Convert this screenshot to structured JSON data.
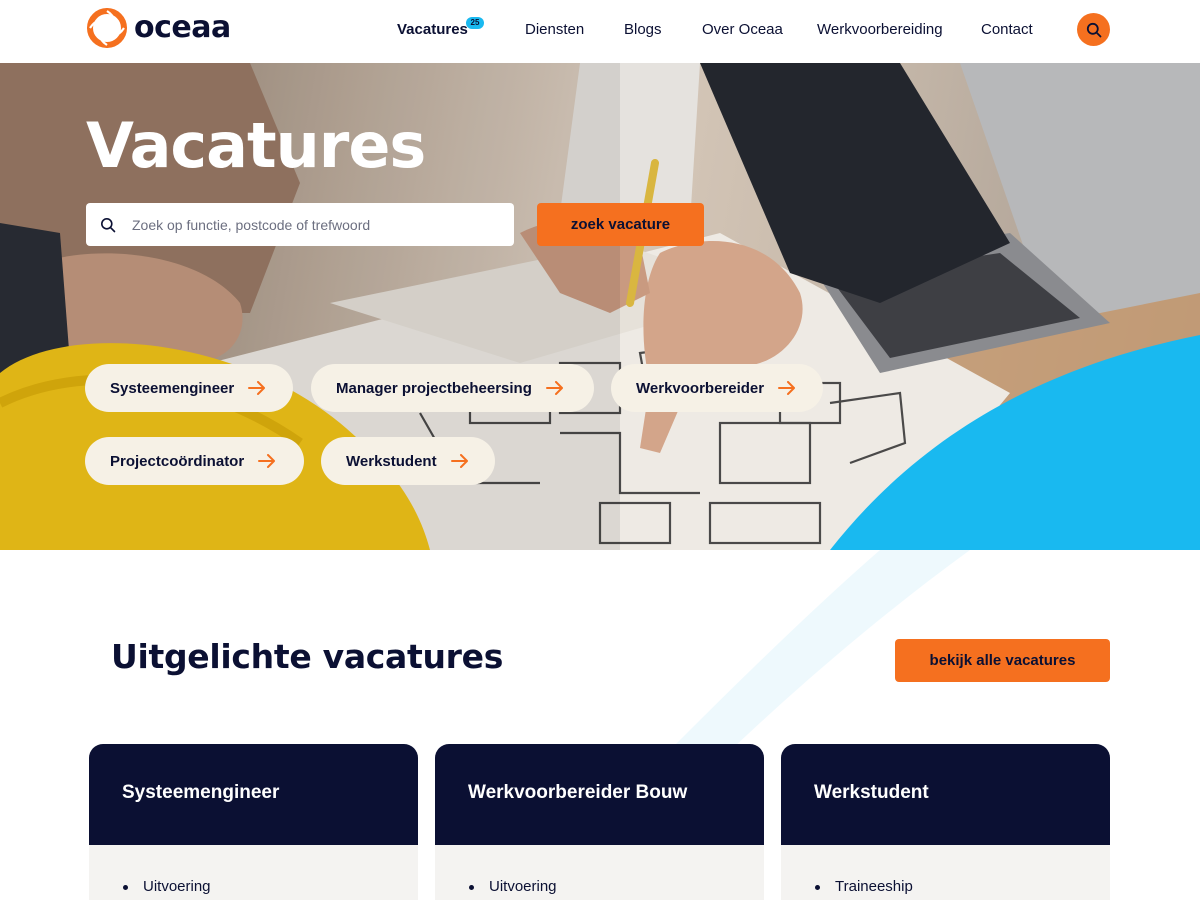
{
  "brand": {
    "name": "oceaa",
    "logo_icon": "swirl-logo-icon"
  },
  "nav": {
    "items": [
      {
        "label": "Vacatures"
      },
      {
        "label": "Diensten"
      },
      {
        "label": "Blogs"
      },
      {
        "label": "Over Oceaa"
      },
      {
        "label": "Werkvoorbereiding"
      },
      {
        "label": "Contact"
      }
    ],
    "badge_count": "25",
    "search_icon": "search-icon"
  },
  "hero": {
    "title": "Vacatures",
    "search": {
      "placeholder": "Zoek op functie, postcode of trefwoord",
      "value": ""
    },
    "search_button": "zoek vacature",
    "quick_links": [
      {
        "label": "Systeemengineer"
      },
      {
        "label": "Manager projectbeheersing"
      },
      {
        "label": "Werkvoorbereider"
      },
      {
        "label": "Projectcoördinator"
      },
      {
        "label": "Werkstudent"
      }
    ]
  },
  "featured": {
    "title": "Uitgelichte vacatures",
    "all_button": "bekijk alle vacatures",
    "cards": [
      {
        "title": "Systeemengineer",
        "items": [
          "Uitvoering"
        ]
      },
      {
        "title": "Werkvoorbereider Bouw",
        "items": [
          "Uitvoering"
        ]
      },
      {
        "title": "Werkstudent",
        "items": [
          "Traineeship"
        ]
      }
    ]
  },
  "colors": {
    "accent_orange": "#f5701f",
    "navy": "#0b1033",
    "sky_blue": "#19b9f0",
    "pill_bg": "#f6f1e6",
    "card_body": "#f4f3f1"
  }
}
